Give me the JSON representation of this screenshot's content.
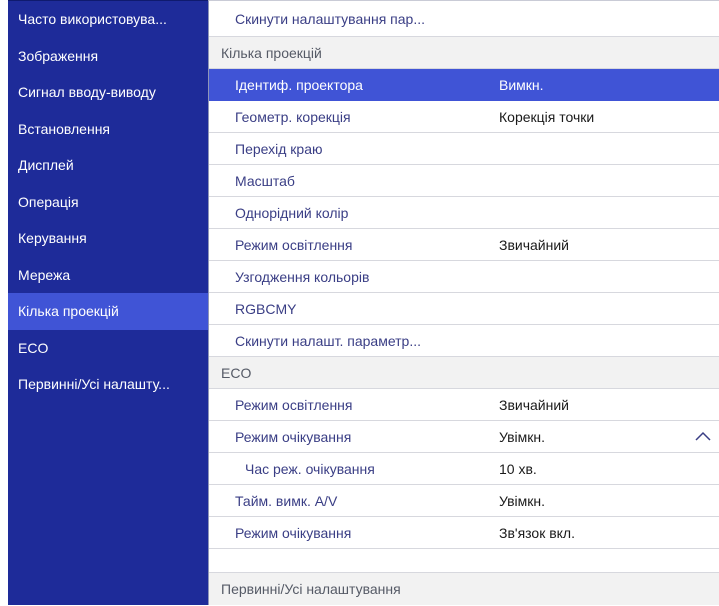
{
  "sidebar": {
    "items": [
      {
        "label": "Часто використовува..."
      },
      {
        "label": "Зображення"
      },
      {
        "label": "Сигнал вводу-виводу"
      },
      {
        "label": "Встановлення"
      },
      {
        "label": "Дисплей"
      },
      {
        "label": "Операція"
      },
      {
        "label": "Керування"
      },
      {
        "label": "Мережа"
      },
      {
        "label": "Кілька проекцій"
      },
      {
        "label": "ECO"
      },
      {
        "label": "Первинні/Усі налашту..."
      }
    ],
    "selected_index": 8
  },
  "main": {
    "top_item": "Скинути налаштування пар...",
    "sections": {
      "multi": {
        "header": "Кілька проекцій",
        "items": [
          {
            "label": "Ідентиф. проектора",
            "value": "Вимкн."
          },
          {
            "label": "Геометр. корекція",
            "value": "Корекція точки"
          },
          {
            "label": "Перехід краю",
            "value": ""
          },
          {
            "label": "Масштаб",
            "value": ""
          },
          {
            "label": "Однорідний колір",
            "value": ""
          },
          {
            "label": "Режим освітлення",
            "value": "Звичайний"
          },
          {
            "label": "Узгодження кольорів",
            "value": ""
          },
          {
            "label": "RGBCMY",
            "value": ""
          },
          {
            "label": "Скинути налашт. параметр...",
            "value": ""
          }
        ]
      },
      "eco": {
        "header": "ECO",
        "items": [
          {
            "label": "Режим освітлення",
            "value": "Звичайний"
          },
          {
            "label": "Режим очікування",
            "value": "Увімкн."
          },
          {
            "label": "Час реж. очікування",
            "value": "10 хв."
          },
          {
            "label": "Тайм. вимк. A/V",
            "value": "Увімкн."
          },
          {
            "label": "Режим очікування",
            "value": "Зв'язок вкл."
          }
        ]
      },
      "footer_header": "Первинні/Усі налаштування"
    }
  },
  "icons": {
    "chevron": "chevron-up-icon"
  },
  "colors": {
    "sidebar_bg": "#1e2b99",
    "highlight": "#4054d6",
    "item_text": "#3a3e85"
  }
}
